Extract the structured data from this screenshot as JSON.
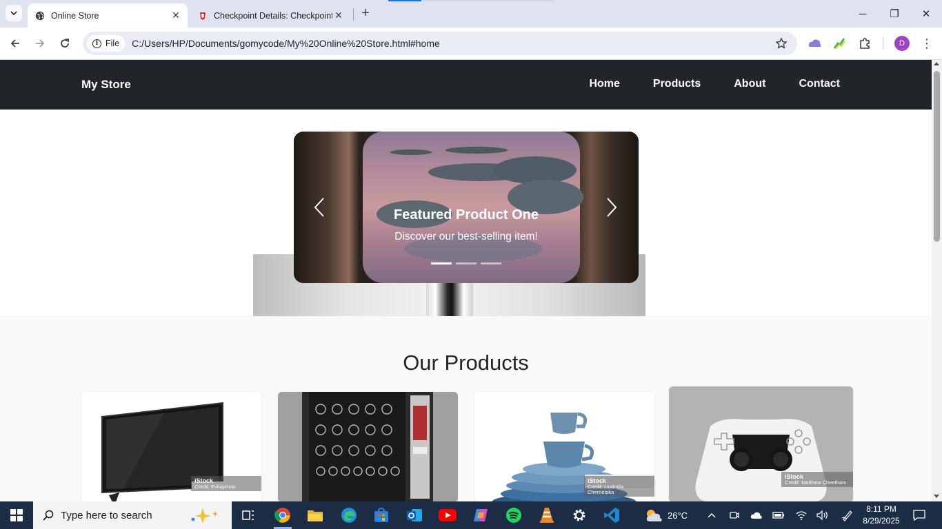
{
  "browser": {
    "tabs": [
      {
        "title": "Online Store",
        "active": true
      },
      {
        "title": "Checkpoint Details: Checkpoint",
        "active": false
      }
    ],
    "close_symbol": "✕",
    "new_tab_symbol": "+",
    "site_info_label": "File",
    "url": "C:/Users/HP/Documents/gomycode/My%20Online%20Store.html#home",
    "profile_initial": "D",
    "window_controls": {
      "minimize": "─",
      "restore": "❐",
      "close": "✕"
    }
  },
  "site": {
    "brand": "My Store",
    "nav": [
      "Home",
      "Products",
      "About",
      "Contact"
    ],
    "carousel": {
      "title": "Featured Product One",
      "caption": "Discover our best-selling item!",
      "slide_count": 3,
      "active_slide": 1
    },
    "products_heading": "Our Products",
    "products": [
      {
        "image": "television",
        "watermark": "iStock",
        "credit": "Credit: Evkaphoto"
      },
      {
        "image": "vending-machine",
        "watermark": "",
        "credit": ""
      },
      {
        "image": "stacked-dishes",
        "watermark": "iStock",
        "credit": "Credit: Liudmila Chernetska"
      },
      {
        "image": "game-controller",
        "watermark": "iStock",
        "credit": "Credit: Matthew Cheetham"
      }
    ]
  },
  "taskbar": {
    "search_placeholder": "Type here to search",
    "weather": "26°C",
    "time": "8:11 PM",
    "date": "8/29/2025",
    "apps": [
      "task-view",
      "chrome",
      "file-explorer",
      "edge",
      "microsoft-store",
      "outlook",
      "youtube",
      "copilot",
      "spotify",
      "vlc",
      "settings",
      "vscode"
    ]
  },
  "colors": {
    "navbar": "#212529",
    "taskbar": "#1c2c44",
    "tabstrip": "#dfe3f0",
    "accent": "#1a73e8"
  }
}
